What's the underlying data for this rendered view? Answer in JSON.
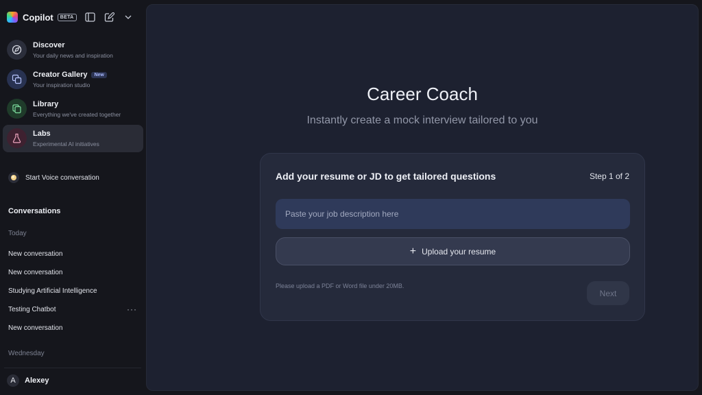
{
  "app": {
    "name": "Copilot",
    "badge": "BETA",
    "tools": [
      "sidebar-toggle-icon",
      "new-chat-icon",
      "chevron-down-icon"
    ]
  },
  "sidebar": {
    "nav": [
      {
        "title": "Discover",
        "subtitle": "Your daily news and inspiration",
        "icon": "compass-icon",
        "color": "#2b2e3b"
      },
      {
        "title": "Creator Gallery",
        "badge": "New",
        "subtitle": "Your inspiration studio",
        "icon": "gallery-icon",
        "color": "#283251"
      },
      {
        "title": "Library",
        "subtitle": "Everything we've created together",
        "icon": "library-icon",
        "color": "#1f3b2a"
      },
      {
        "title": "Labs",
        "subtitle": "Experimental AI initiatives",
        "icon": "flask-icon",
        "color": "#3e2130",
        "active": true
      }
    ],
    "voice": {
      "label": "Start Voice conversation",
      "icon": "voice-orb-icon"
    },
    "conversations": {
      "heading": "Conversations",
      "groups": [
        {
          "label": "Today",
          "items": [
            "New conversation",
            "New conversation",
            "Studying Artificial Intelligence",
            "Testing Chatbot",
            "New conversation"
          ]
        },
        {
          "label": "Wednesday",
          "items": []
        }
      ],
      "more_label": "···"
    },
    "user": {
      "initial": "A",
      "name": "Alexey"
    }
  },
  "main": {
    "title": "Career Coach",
    "subtitle": "Instantly create a mock interview tailored to you",
    "card": {
      "title": "Add your resume or JD to get tailored questions",
      "step": "Step 1 of 2",
      "input_placeholder": "Paste your job description here",
      "input_value": "",
      "upload_label": "Upload your resume",
      "help_text": "Please upload a PDF or Word file under 20MB.",
      "next_label": "Next"
    }
  },
  "colors": {
    "background": "#15161c",
    "panel": "#1d2130",
    "card": "#252a3b",
    "input": "#2f3a5a"
  }
}
